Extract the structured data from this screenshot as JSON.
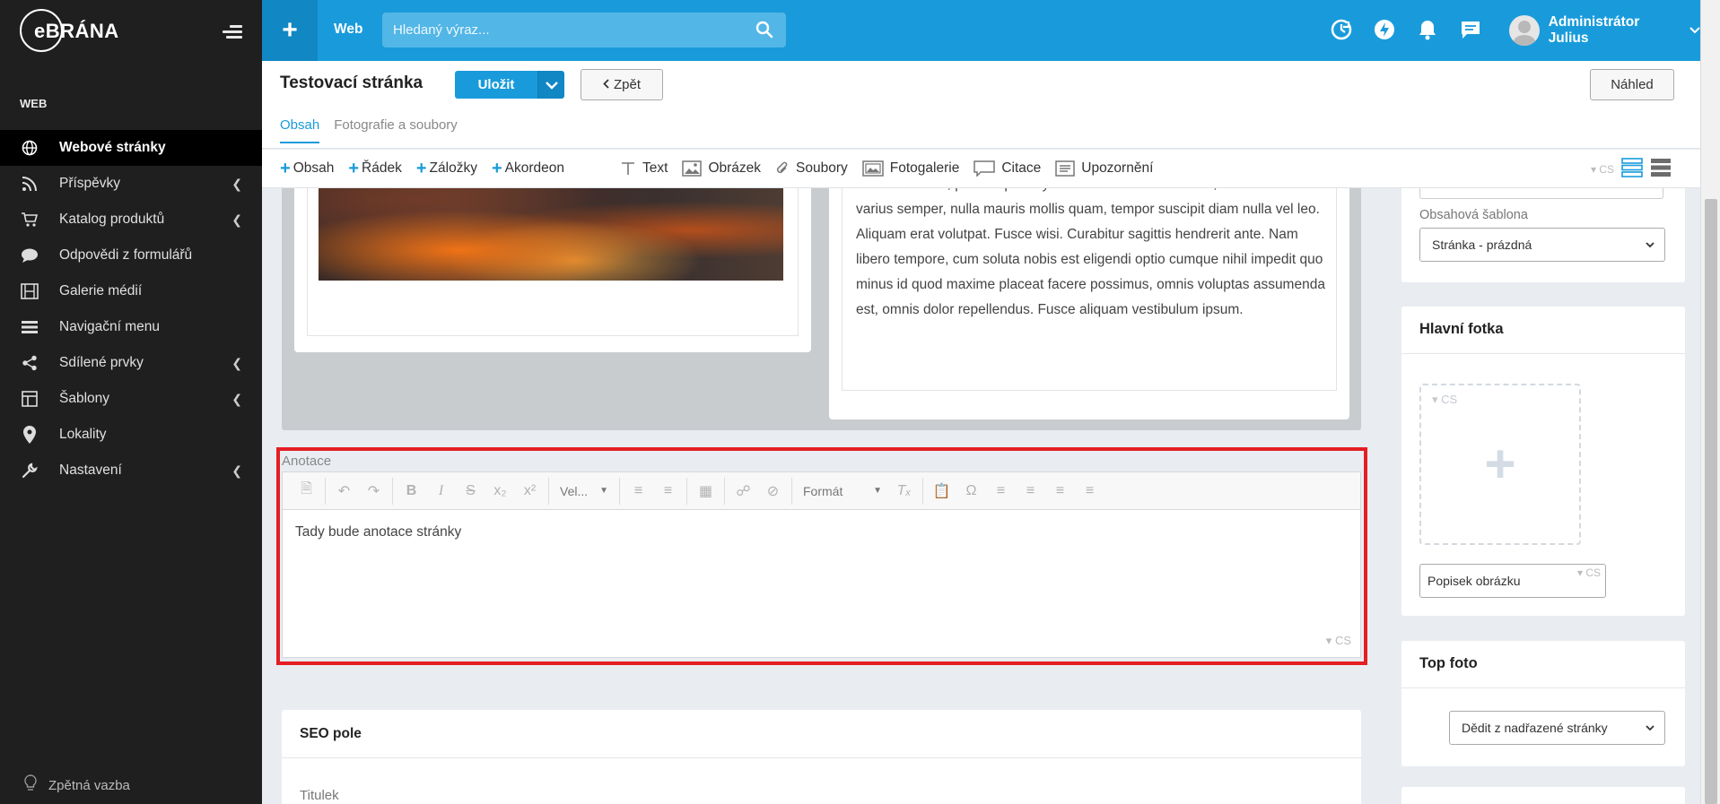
{
  "sidebar": {
    "logo": "eBRÁNA",
    "section_label": "WEB",
    "items": [
      {
        "label": "Webové stránky",
        "icon": "globe-icon",
        "active": true,
        "has_submenu": false
      },
      {
        "label": "Příspěvky",
        "icon": "rss-icon",
        "active": false,
        "has_submenu": true
      },
      {
        "label": "Katalog produktů",
        "icon": "cart-icon",
        "active": false,
        "has_submenu": true
      },
      {
        "label": "Odpovědi z formulářů",
        "icon": "chat-icon",
        "active": false,
        "has_submenu": false
      },
      {
        "label": "Galerie médií",
        "icon": "film-icon",
        "active": false,
        "has_submenu": false
      },
      {
        "label": "Navigační menu",
        "icon": "bars-icon",
        "active": false,
        "has_submenu": false
      },
      {
        "label": "Sdílené prvky",
        "icon": "share-icon",
        "active": false,
        "has_submenu": true
      },
      {
        "label": "Šablony",
        "icon": "template-icon",
        "active": false,
        "has_submenu": true
      },
      {
        "label": "Lokality",
        "icon": "map-pin-icon",
        "active": false,
        "has_submenu": false
      },
      {
        "label": "Nastavení",
        "icon": "wrench-icon",
        "active": false,
        "has_submenu": true
      }
    ],
    "feedback": "Zpětná vazba"
  },
  "topbar": {
    "web_label": "Web",
    "search_placeholder": "Hledaný výraz...",
    "user_name": "Administrátor Julius"
  },
  "page": {
    "title": "Testovací stránka",
    "save_label": "Uložit",
    "back_label": "Zpět",
    "preview_label": "Náhled",
    "tabs": [
      "Obsah",
      "Fotografie a soubory"
    ]
  },
  "toolbar": {
    "add_items": [
      "Obsah",
      "Řádek",
      "Záložky",
      "Akordeon"
    ],
    "blocks": [
      {
        "label": "Text",
        "icon": "text-icon"
      },
      {
        "label": "Obrázek",
        "icon": "image-icon"
      },
      {
        "label": "Soubory",
        "icon": "paperclip-icon"
      },
      {
        "label": "Fotogalerie",
        "icon": "gallery-icon"
      },
      {
        "label": "Citace",
        "icon": "quote-icon"
      },
      {
        "label": "Upozornění",
        "icon": "notice-icon"
      }
    ],
    "lang": "CS"
  },
  "content": {
    "lorem": "conubia nostra, per inceptos hymenaeos. Nulla accumsan, elit sit amet varius semper, nulla mauris mollis quam, tempor suscipit diam nulla vel leo. Aliquam erat volutpat. Fusce wisi. Curabitur sagittis hendrerit ante. Nam libero tempore, cum soluta nobis est eligendi optio cumque nihil impedit quo minus id quod maxime placeat facere possimus, omnis voluptas assumenda est, omnis dolor repellendus. Fusce aliquam vestibulum ipsum.",
    "annotation_label": "Anotace",
    "editor": {
      "size_combo": "Vel...",
      "format_combo": "Formát",
      "body_text": "Tady bude anotace stránky",
      "lang": "CS"
    },
    "seo": {
      "title": "SEO pole",
      "field_label": "Titulek"
    }
  },
  "right": {
    "template_label": "Obsahová šablona",
    "template_value": "Stránka - prázdná",
    "main_photo_title": "Hlavní fotka",
    "photo_lang": "CS",
    "caption_placeholder": "Popisek obrázku",
    "caption_lang": "CS",
    "top_photo_title": "Top foto",
    "top_photo_value": "Dědit z nadřazené stránky"
  },
  "colors": {
    "accent": "#199bdb",
    "sidebar": "#1f1f1f",
    "highlight": "#e31e24"
  }
}
